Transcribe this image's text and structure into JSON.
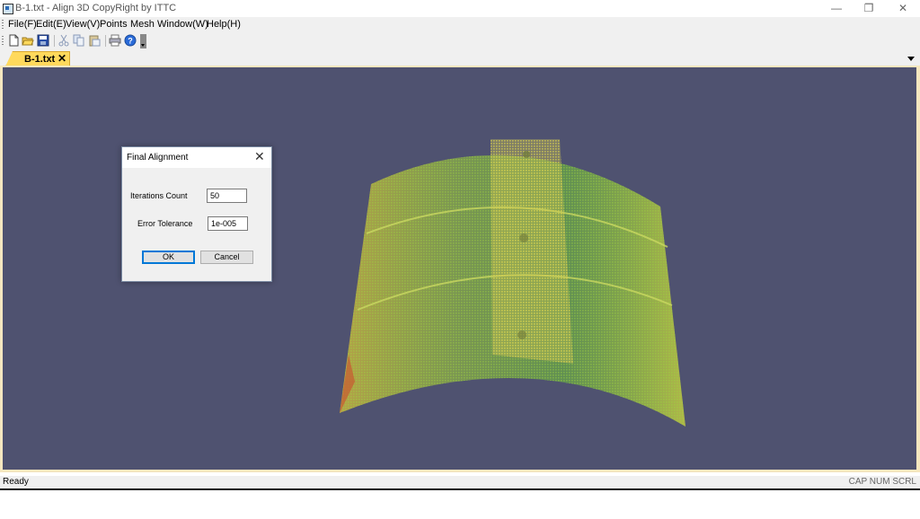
{
  "window": {
    "title": "B-1.txt - Align 3D CopyRight by ITTC",
    "minimize_glyph": "—",
    "maximize_glyph": "❐",
    "close_glyph": "✕"
  },
  "menu": {
    "items": [
      "File(F)",
      "Edit(E)",
      "View(V)",
      "Points",
      "Mesh",
      "Window(W)",
      "Help(H)"
    ]
  },
  "toolbar": {
    "icons": [
      "new-icon",
      "open-icon",
      "save-icon",
      "cut-icon",
      "copy-icon",
      "paste-icon",
      "print-icon",
      "help-icon"
    ]
  },
  "tab": {
    "label": "B-1.txt",
    "close_glyph": "✕"
  },
  "status": {
    "left": "Ready",
    "right": "CAP NUM SCRL"
  },
  "dialog": {
    "title": "Final Alignment",
    "close_glyph": "✕",
    "iterations_label": "Iterations Count",
    "iterations_value": "50",
    "tolerance_label": "Error Tolerance",
    "tolerance_value": "1e-005",
    "ok_label": "OK",
    "cancel_label": "Cancel"
  },
  "colors": {
    "viewport_bg": "#4f5270",
    "tab_active": "#ffd95c",
    "point_cloud_green": "#7ec83a",
    "point_cloud_yellow": "#d6d24a"
  }
}
